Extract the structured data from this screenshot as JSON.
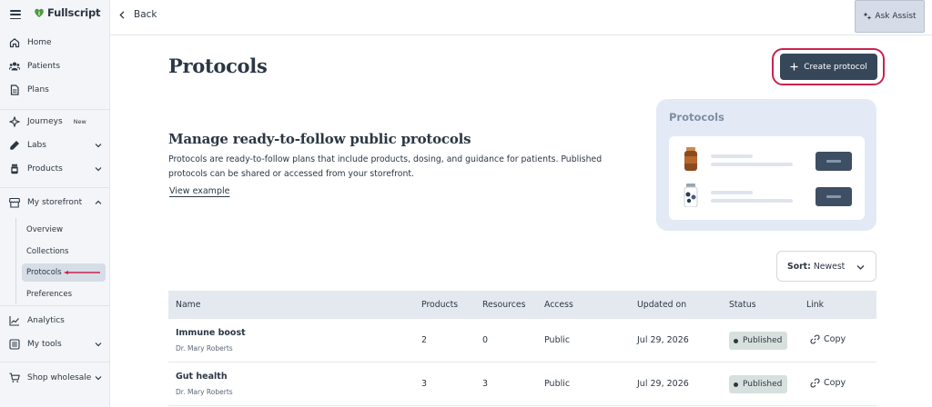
{
  "brand": {
    "name": "Fullscript",
    "accent": "#4c9a3c"
  },
  "sidebar": {
    "items": [
      {
        "label": "Home",
        "icon": "home-icon"
      },
      {
        "label": "Patients",
        "icon": "patients-icon"
      },
      {
        "label": "Plans",
        "icon": "plans-icon"
      },
      {
        "label": "Journeys",
        "icon": "journeys-icon",
        "badge": "New"
      },
      {
        "label": "Labs",
        "icon": "labs-icon"
      },
      {
        "label": "Products",
        "icon": "products-icon"
      },
      {
        "label": "My storefront",
        "icon": "storefront-icon"
      },
      {
        "label": "Analytics",
        "icon": "analytics-icon"
      },
      {
        "label": "My tools",
        "icon": "tools-icon"
      },
      {
        "label": "Shop wholesale",
        "icon": "cart-icon"
      }
    ],
    "storefront_sub": [
      "Overview",
      "Collections",
      "Protocols",
      "Preferences"
    ],
    "active_sub": "Protocols"
  },
  "topbar": {
    "back_label": "Back",
    "assist_label": "Ask Assist"
  },
  "page": {
    "title": "Protocols",
    "create_label": "Create protocol",
    "section_title": "Manage ready-to-follow public protocols",
    "section_desc": "Protocols are ready-to-follow plans that include products, dosing, and guidance for patients. Published protocols can be shared or accessed from your storefront.",
    "view_example": "View example",
    "illustration_title": "Protocols"
  },
  "sort": {
    "label": "Sort:",
    "value": "Newest"
  },
  "table": {
    "headers": [
      "Name",
      "Products",
      "Resources",
      "Access",
      "Updated on",
      "Status",
      "Link"
    ],
    "rows": [
      {
        "name": "Immune boost",
        "author": "Dr. Mary Roberts",
        "products": "2",
        "resources": "0",
        "access": "Public",
        "updated": "Jul 29, 2026",
        "status": "Published",
        "link": "Copy"
      },
      {
        "name": "Gut health",
        "author": "Dr. Mary Roberts",
        "products": "3",
        "resources": "3",
        "access": "Public",
        "updated": "Jul 29, 2026",
        "status": "Published",
        "link": "Copy"
      }
    ]
  }
}
